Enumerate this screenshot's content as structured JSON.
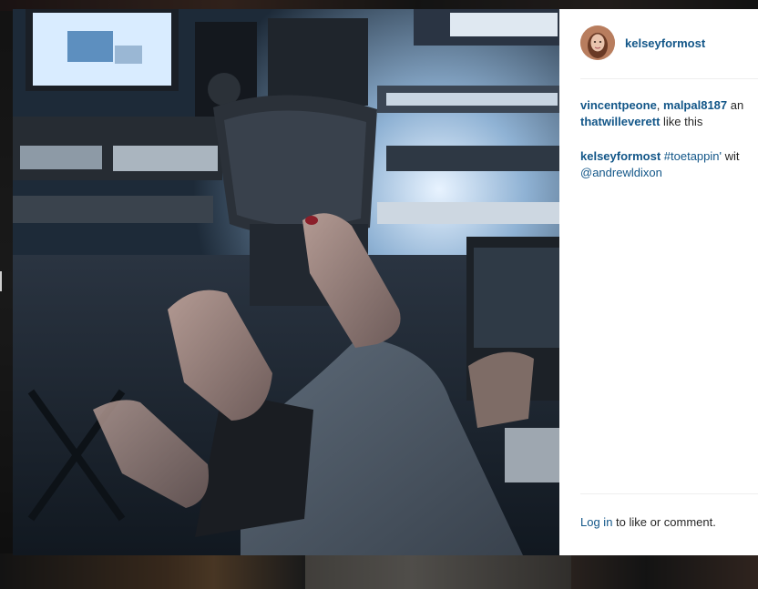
{
  "post": {
    "username": "kelseyformost",
    "avatar_icon": "profile-avatar",
    "likes": {
      "likers": [
        "vincentpeone",
        "malpal8187",
        "thatwilleverett"
      ],
      "separator": ", ",
      "trailing_partial": " an",
      "suffix": " like this"
    },
    "caption": {
      "author": "kelseyformost",
      "hashtag": "#toetappin'",
      "after_hashtag": " wit",
      "mention": "@andrewldixon"
    },
    "footer": {
      "login_link": "Log in",
      "login_suffix": " to like or comment."
    }
  },
  "colors": {
    "link": "#125688",
    "text": "#262626",
    "panel_bg": "#ffffff",
    "overlay": "#1b1b1b"
  }
}
